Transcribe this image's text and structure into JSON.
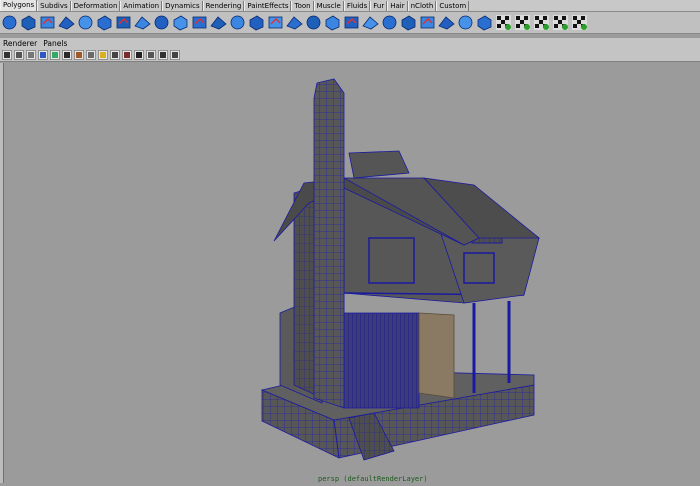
{
  "shelf_tabs": [
    {
      "label": "Polygons",
      "active": true
    },
    {
      "label": "Subdivs",
      "active": false
    },
    {
      "label": "Deformation",
      "active": false
    },
    {
      "label": "Animation",
      "active": false
    },
    {
      "label": "Dynamics",
      "active": false
    },
    {
      "label": "Rendering",
      "active": false
    },
    {
      "label": "PaintEffects",
      "active": false
    },
    {
      "label": "Toon",
      "active": false
    },
    {
      "label": "Muscle",
      "active": false
    },
    {
      "label": "Fluids",
      "active": false
    },
    {
      "label": "Fur",
      "active": false
    },
    {
      "label": "Hair",
      "active": false
    },
    {
      "label": "nCloth",
      "active": false
    },
    {
      "label": "Custom",
      "active": false
    }
  ],
  "shelf_icons": [
    "poly-sphere-icon",
    "poly-cube-icon",
    "poly-cylinder-icon",
    "poly-cone-icon",
    "poly-plane-icon",
    "poly-torus-icon",
    "combine-icon",
    "separate-icon",
    "extract-icon",
    "smooth-icon",
    "boolean-icon",
    "mirror-icon",
    "extrude-icon",
    "bridge-icon",
    "append-icon",
    "split-icon",
    "insert-edge-loop-icon",
    "offset-edge-loop-icon",
    "merge-icon",
    "bevel-icon",
    "wedge-icon",
    "duplicate-face-icon",
    "poke-icon",
    "cut-faces-icon",
    "uv-editor-icon",
    "planar-map-icon",
    "cylindrical-map-icon",
    "spherical-map-icon",
    "auto-map-icon",
    "sew-uv-icon",
    "select-tool-icon"
  ],
  "panel_menu": [
    {
      "label": "Renderer"
    },
    {
      "label": "Panels"
    }
  ],
  "panel_tools": [
    "camera-select-icon",
    "camera-attr-icon",
    "bookmark-icon",
    "image-plane-icon",
    "grid-icon",
    "wireframe-icon",
    "smooth-shade-icon",
    "textured-icon",
    "lights-icon",
    "shadows-icon",
    "isolate-icon",
    "xray-icon",
    "single-view-icon",
    "four-view-icon",
    "outliner-view-icon"
  ],
  "viewport": {
    "camera_name": "persp (defaultRenderLayer)",
    "bg_color": "#9b9b9b",
    "wire_color": "#1a1aa0",
    "mesh_color": "#505050"
  }
}
